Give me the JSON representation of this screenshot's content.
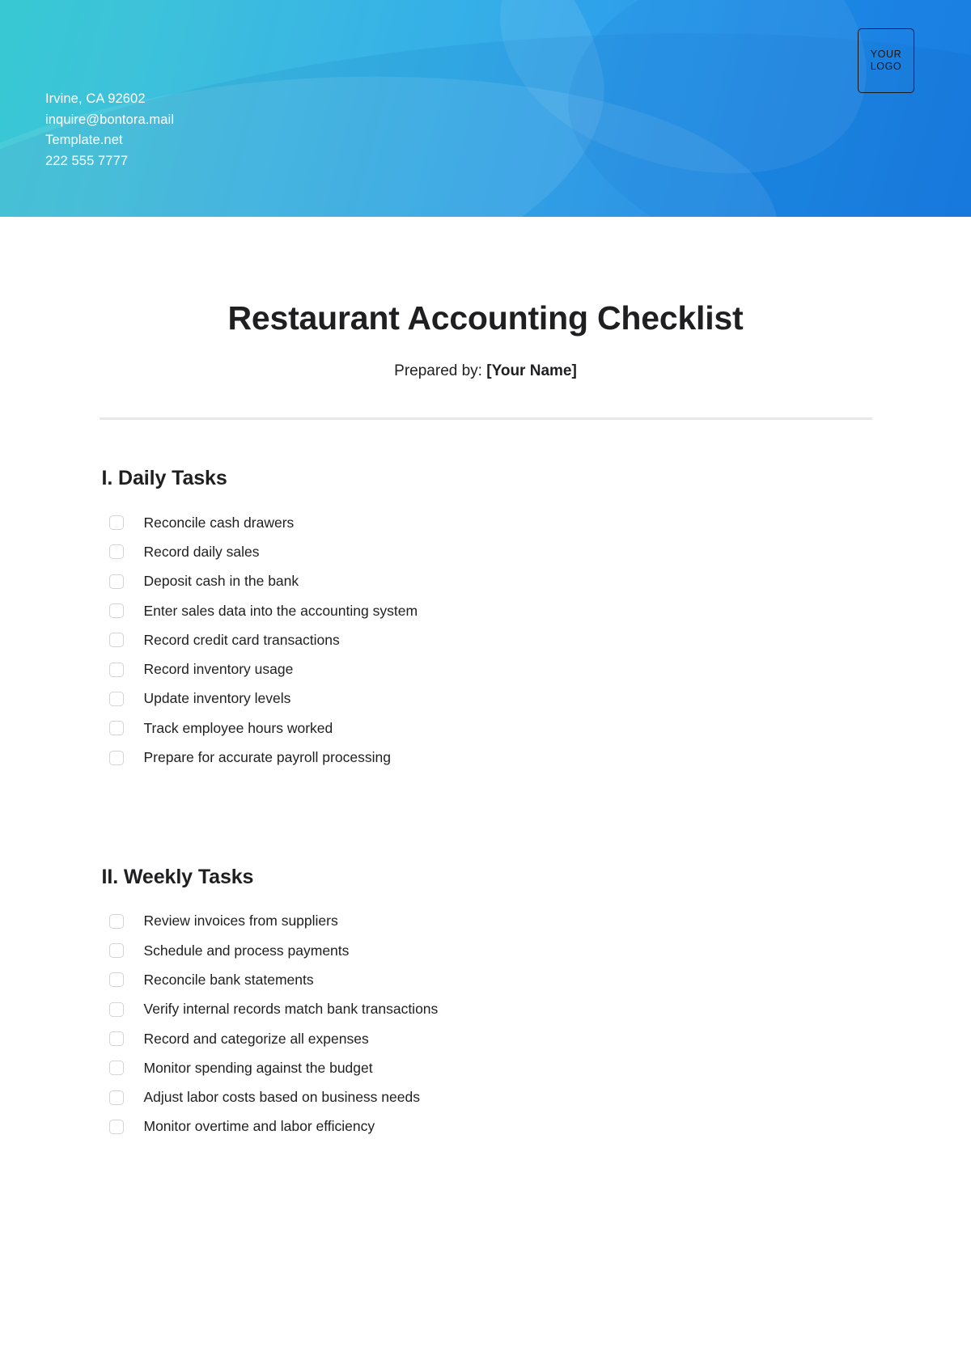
{
  "header": {
    "contact": [
      "Irvine, CA 92602",
      "inquire@bontora.mail",
      "Template.net",
      "222 555 7777"
    ],
    "logo": {
      "line1": "YOUR",
      "line2": "LOGO"
    },
    "colors": {
      "gradient_start": "#21c3cf",
      "gradient_end": "#1c80e4"
    }
  },
  "document": {
    "title": "Restaurant Accounting Checklist",
    "prepared_by_label": "Prepared by:",
    "prepared_by_value": "[Your Name]",
    "divider_color": "#e8e8e9",
    "sections": [
      {
        "heading": "I. Daily Tasks",
        "tasks": [
          "Reconcile cash drawers",
          "Record daily sales",
          "Deposit cash in the bank",
          "Enter sales data into the accounting system",
          "Record credit card transactions",
          "Record inventory usage",
          "Update inventory levels",
          "Track employee hours worked",
          "Prepare for accurate payroll processing"
        ]
      },
      {
        "heading": "II. Weekly Tasks",
        "tasks": [
          "Review invoices from suppliers",
          "Schedule and process payments",
          "Reconcile bank statements",
          "Verify internal records match bank transactions",
          "Record and categorize all expenses",
          "Monitor spending against the budget",
          "Adjust labor costs based on business needs",
          "Monitor overtime and labor efficiency"
        ]
      }
    ]
  }
}
